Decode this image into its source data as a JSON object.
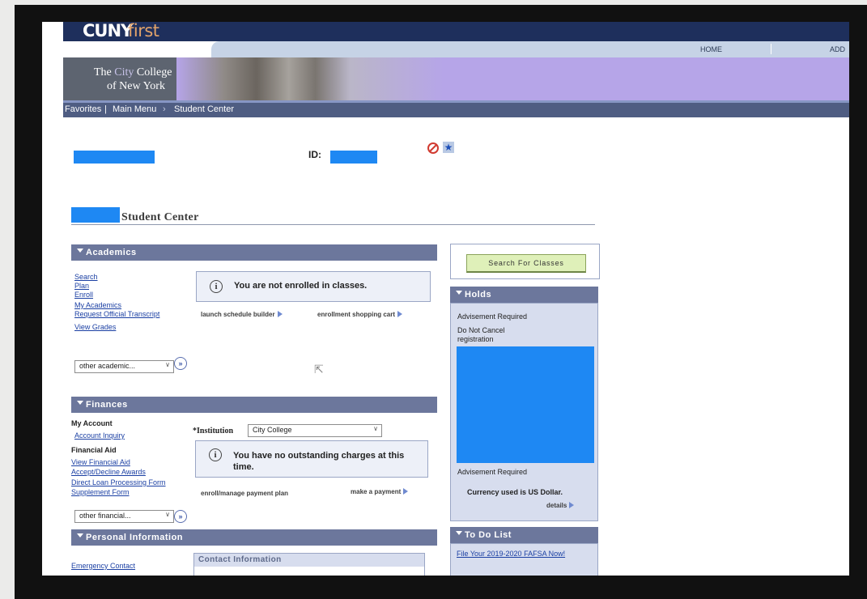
{
  "brand": {
    "logo_bold": "CUNY",
    "logo_light": "first",
    "college_line1_pre": "The ",
    "college_line1_accent": "City",
    "college_line1_post": " College",
    "college_line2": "of New York"
  },
  "top_links": {
    "home": "HOME",
    "add": "ADD"
  },
  "nav": {
    "favorites": "Favorites",
    "main_menu": "Main Menu",
    "student_center": "Student Center",
    "sep": "|",
    "arrow": "›"
  },
  "student": {
    "id_label": "ID:"
  },
  "page": {
    "title": "Student Center"
  },
  "academics": {
    "header": "Academics",
    "links": [
      "Search",
      "Plan",
      "Enroll",
      "My Academics",
      "Request Official Transcript",
      "View Grades"
    ],
    "notice": "You are not enrolled in classes.",
    "schedule_builder": "launch schedule builder",
    "shopping_cart": "enrollment shopping cart",
    "other_select": "other academic...",
    "go": "»"
  },
  "finances": {
    "header": "Finances",
    "my_account": "My Account",
    "account_inquiry": "Account Inquiry",
    "financial_aid": "Financial Aid",
    "aid_links": [
      "View Financial Aid",
      "Accept/Decline Awards",
      "Direct Loan Processing Form",
      "Supplement Form"
    ],
    "institution_label": "*Institution",
    "institution_value": "City College",
    "notice_line1": "You have no outstanding charges at this",
    "notice_line2": "time.",
    "payment_plan": "enroll/manage payment plan",
    "make_payment": "make a payment",
    "other_select": "other financial...",
    "go": "»"
  },
  "personal": {
    "header": "Personal Information",
    "emergency_contact": "Emergency Contact",
    "contact_info": "Contact Information"
  },
  "search_button": "Search For Classes",
  "holds": {
    "header": "Holds",
    "item1": "Advisement Required",
    "item2_line1": "Do Not Cancel",
    "item2_line2": "registration",
    "item3": "Advisement Required",
    "currency": "Currency used is US Dollar.",
    "details": "details"
  },
  "todo": {
    "header": "To Do List",
    "item1": "File Your 2019-2020 FAFSA Now!"
  },
  "colors": {
    "header_navy": "#1e2f5c",
    "banner_purple": "#b6a5e8",
    "panel_header": "#6c779c",
    "redaction_blue": "#1e88f3",
    "link_blue": "#1a3fa3",
    "search_button_green": "#dff0b9"
  }
}
